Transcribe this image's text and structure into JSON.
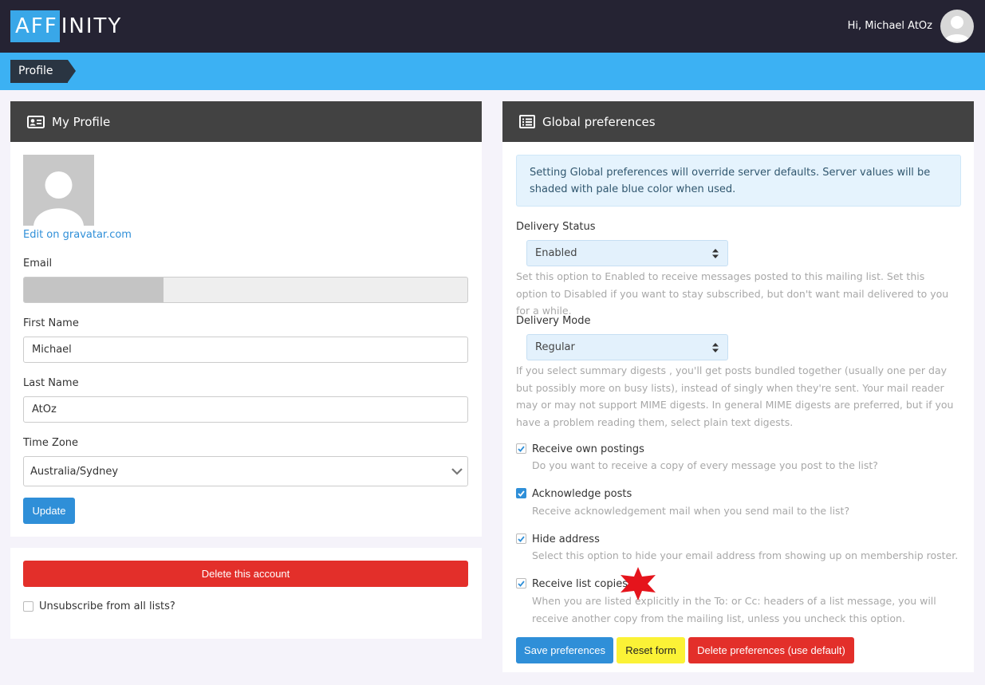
{
  "brand": {
    "logo_highlight": "AFF",
    "logo_rest": "INITY"
  },
  "header": {
    "greeting": "Hi, Michael AtOz"
  },
  "breadcrumb": {
    "current": "Profile"
  },
  "profile": {
    "title": "My Profile",
    "gravatar_link": "Edit on gravatar.com",
    "email_label": "Email",
    "first_name_label": "First Name",
    "first_name_value": "Michael",
    "last_name_label": "Last Name",
    "last_name_value": "AtOz",
    "timezone_label": "Time Zone",
    "timezone_value": "Australia/Sydney",
    "update_label": "Update"
  },
  "account": {
    "delete_label": "Delete this account",
    "unsubscribe_label": "Unsubscribe from all lists?"
  },
  "prefs": {
    "title": "Global preferences",
    "info": "Setting Global preferences will override server defaults. Server values will be shaded with pale blue color when used.",
    "delivery_status_label": "Delivery Status",
    "delivery_status_value": "Enabled",
    "delivery_status_help": "Set this option to Enabled to receive messages posted to this mailing list. Set this option to Disabled if you want to stay subscribed, but don't want mail delivered to you for a while.",
    "delivery_mode_label": "Delivery Mode",
    "delivery_mode_value": "Regular",
    "delivery_mode_help": "If you select summary digests , you'll get posts bundled together (usually one per day but possibly more on busy lists), instead of singly when they're sent. Your mail reader may or may not support MIME digests. In general MIME digests are preferred, but if you have a problem reading them, select plain text digests.",
    "options": [
      {
        "title": "Receive own postings",
        "help": "Do you want to receive a copy of every message you post to the list?"
      },
      {
        "title": "Acknowledge posts",
        "help": "Receive acknowledgement mail when you send mail to the list?"
      },
      {
        "title": "Hide address",
        "help": "Select this option to hide your email address from showing up on membership roster."
      },
      {
        "title": "Receive list copies",
        "help": "When you are listed explicitly in the To: or Cc: headers of a list message, you will receive another copy from the mailing list, unless you uncheck this option."
      }
    ],
    "save_label": "Save preferences",
    "reset_label": "Reset form",
    "delete_label": "Delete preferences (use default)"
  },
  "colors": {
    "accent": "#3cb1f3",
    "topbar": "#252333",
    "panel_head": "#424242",
    "danger": "#e32f2a",
    "warning": "#fbf236",
    "primary": "#2f8fd8"
  }
}
